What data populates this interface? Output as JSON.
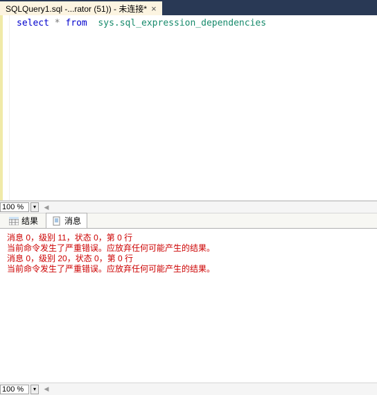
{
  "tab": {
    "title": "SQLQuery1.sql -...rator (51)) - 未连接*"
  },
  "code": {
    "kw1": "select",
    "star": " * ",
    "kw2": "from",
    "obj": "  sys.sql_expression_dependencies"
  },
  "zoom": {
    "top_value": "100 %",
    "bottom_value": "100 %"
  },
  "result_tabs": {
    "results_label": "结果",
    "messages_label": "消息"
  },
  "messages": {
    "lines": [
      "消息 0，级别 11，状态 0，第 0 行",
      "当前命令发生了严重错误。应放弃任何可能产生的结果。",
      "消息 0，级别 20，状态 0，第 0 行",
      "当前命令发生了严重错误。应放弃任何可能产生的结果。"
    ]
  }
}
